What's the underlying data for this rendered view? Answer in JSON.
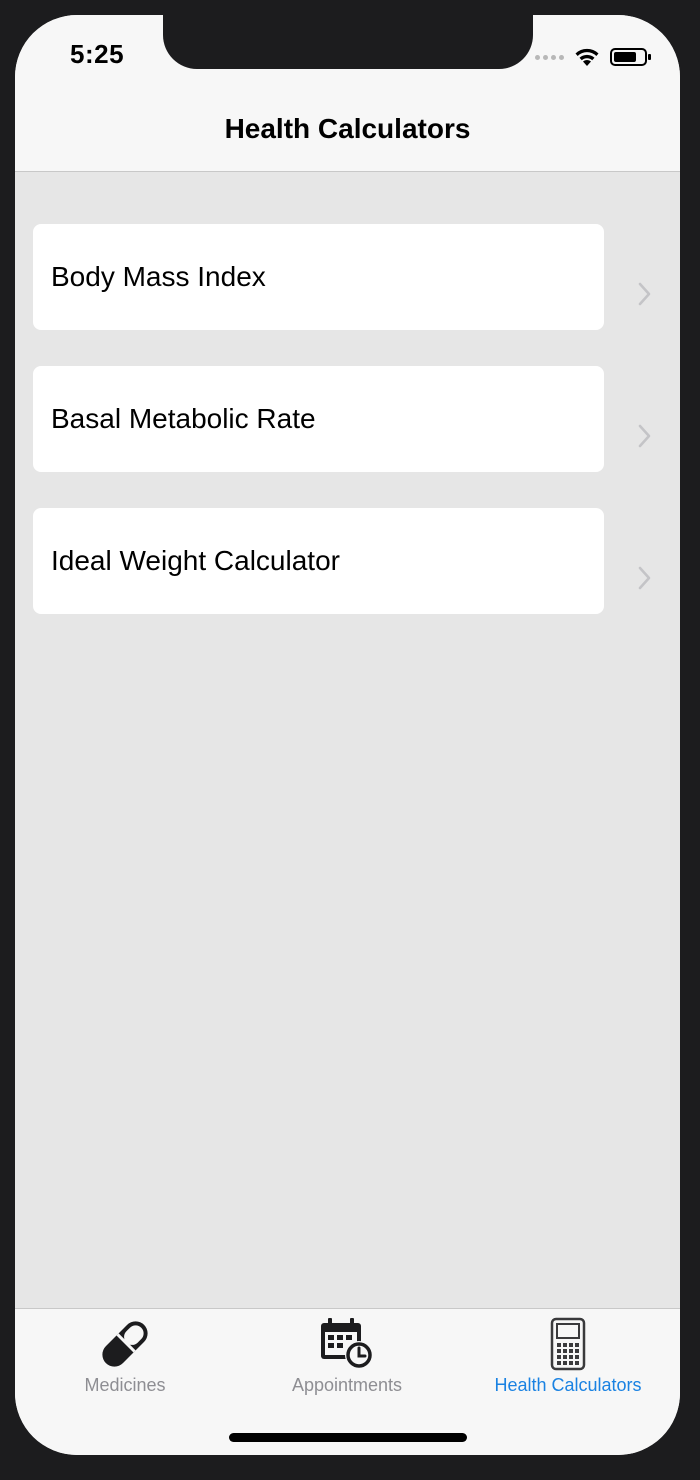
{
  "status_bar": {
    "time": "5:25"
  },
  "nav": {
    "title": "Health Calculators"
  },
  "calculators": [
    {
      "label": "Body Mass Index"
    },
    {
      "label": "Basal Metabolic Rate"
    },
    {
      "label": "Ideal Weight Calculator"
    }
  ],
  "tab_bar": {
    "tabs": [
      {
        "label": "Medicines",
        "icon": "pill-icon",
        "active": false
      },
      {
        "label": "Appointments",
        "icon": "calendar-clock-icon",
        "active": false
      },
      {
        "label": "Health Calculators",
        "icon": "calculator-icon",
        "active": true
      }
    ]
  },
  "colors": {
    "accent": "#1a82e2",
    "inactive": "#8e8e93",
    "background": "#e6e6e6",
    "card": "#ffffff",
    "bar": "#f7f7f7"
  }
}
